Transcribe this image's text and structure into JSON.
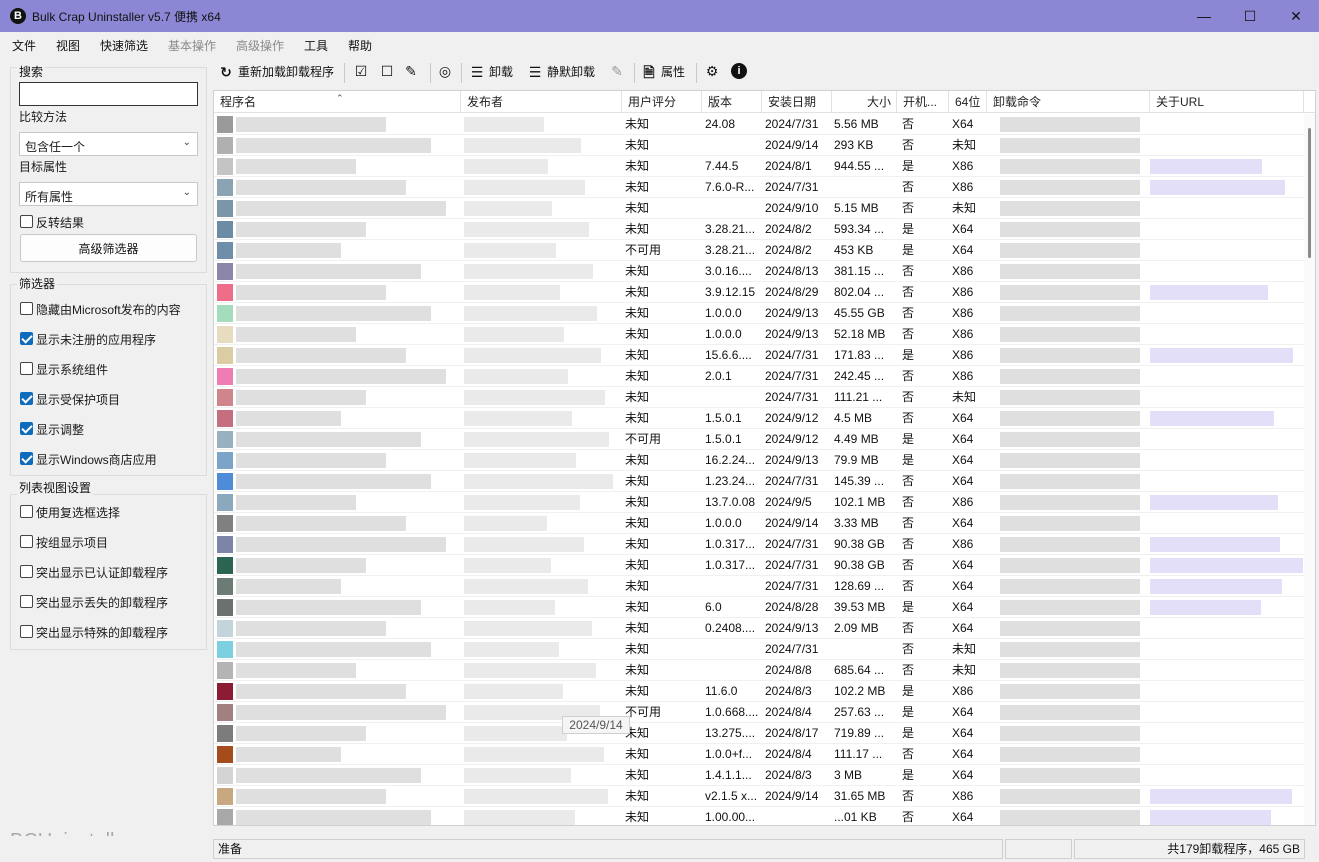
{
  "window": {
    "title": "Bulk Crap Uninstaller v5.7 便携 x64",
    "app_icon_letter": "B"
  },
  "menu": [
    {
      "label": "文件",
      "enabled": true
    },
    {
      "label": "视图",
      "enabled": true
    },
    {
      "label": "快速筛选",
      "enabled": true
    },
    {
      "label": "基本操作",
      "enabled": false
    },
    {
      "label": "高级操作",
      "enabled": false
    },
    {
      "label": "工具",
      "enabled": true
    },
    {
      "label": "帮助",
      "enabled": true
    }
  ],
  "search": {
    "title": "搜索",
    "value": "",
    "compare_label": "比较方法",
    "compare_value": "包含任一个",
    "target_label": "目标属性",
    "target_value": "所有属性",
    "invert": {
      "label": "反转结果",
      "checked": false
    },
    "advanced_button": "高级筛选器"
  },
  "filters": {
    "title": "筛选器",
    "items": [
      {
        "label": "隐藏由Microsoft发布的内容",
        "checked": false
      },
      {
        "label": "显示未注册的应用程序",
        "checked": true
      },
      {
        "label": "显示系统组件",
        "checked": false
      },
      {
        "label": "显示受保护项目",
        "checked": true
      },
      {
        "label": "显示调整",
        "checked": true
      },
      {
        "label": "显示Windows商店应用",
        "checked": true
      }
    ]
  },
  "listview_settings": {
    "title": "列表视图设置",
    "items": [
      {
        "label": "使用复选框选择",
        "checked": false
      },
      {
        "label": "按组显示项目",
        "checked": false
      },
      {
        "label": "突出显示已认证卸载程序",
        "checked": false
      },
      {
        "label": "突出显示丢失的卸载程序",
        "checked": false
      },
      {
        "label": "突出显示特殊的卸载程序",
        "checked": false
      }
    ]
  },
  "brand": "BCUninstaller",
  "toolbar": {
    "reload": "重新加载卸载程序",
    "uninstall": "卸载",
    "quiet_uninstall": "静默卸载",
    "properties": "属性"
  },
  "columns": {
    "name": "程序名",
    "publisher": "发布者",
    "rating": "用户评分",
    "version": "版本",
    "install_date": "安装日期",
    "size": "大小",
    "startup": "开机...",
    "x64": "64位",
    "uninstall_cmd": "卸载命令",
    "about_url": "关于URL"
  },
  "rows": [
    {
      "color": "#9a9a9a",
      "rating": "未知",
      "version": "24.08",
      "date": "2024/7/31",
      "size": "5.56 MB",
      "startup": "否",
      "arch": "X64",
      "url": false
    },
    {
      "color": "#b0b0b0",
      "rating": "未知",
      "version": "",
      "date": "2024/9/14",
      "size": "293 KB",
      "startup": "否",
      "arch": "未知",
      "url": false
    },
    {
      "color": "#c4c4c4",
      "rating": "未知",
      "version": "7.44.5",
      "date": "2024/8/1",
      "size": "944.55 ...",
      "startup": "是",
      "arch": "X86",
      "url": true
    },
    {
      "color": "#8aa4b4",
      "rating": "未知",
      "version": "7.6.0-R...",
      "date": "2024/7/31",
      "size": "",
      "startup": "否",
      "arch": "X86",
      "url": true
    },
    {
      "color": "#7a96a8",
      "rating": "未知",
      "version": "",
      "date": "2024/9/10",
      "size": "5.15 MB",
      "startup": "否",
      "arch": "未知",
      "url": false
    },
    {
      "color": "#6c8ca6",
      "rating": "未知",
      "version": "3.28.21...",
      "date": "2024/8/2",
      "size": "593.34 ...",
      "startup": "是",
      "arch": "X64",
      "url": false
    },
    {
      "color": "#6e8eaa",
      "rating": "不可用",
      "version": "3.28.21...",
      "date": "2024/8/2",
      "size": "453 KB",
      "startup": "是",
      "arch": "X64",
      "url": false
    },
    {
      "color": "#8c86a8",
      "rating": "未知",
      "version": "3.0.16....",
      "date": "2024/8/13",
      "size": "381.15 ...",
      "startup": "否",
      "arch": "X86",
      "url": false
    },
    {
      "color": "#ee6e8a",
      "rating": "未知",
      "version": "3.9.12.15",
      "date": "2024/8/29",
      "size": "802.04 ...",
      "startup": "否",
      "arch": "X86",
      "url": true
    },
    {
      "color": "#a4dcbc",
      "rating": "未知",
      "version": "1.0.0.0",
      "date": "2024/9/13",
      "size": "45.55 GB",
      "startup": "否",
      "arch": "X86",
      "url": false
    },
    {
      "color": "#e8dcc0",
      "rating": "未知",
      "version": "1.0.0.0",
      "date": "2024/9/13",
      "size": "52.18 MB",
      "startup": "否",
      "arch": "X86",
      "url": false
    },
    {
      "color": "#dccca4",
      "rating": "未知",
      "version": "15.6.6....",
      "date": "2024/7/31",
      "size": "171.83 ...",
      "startup": "是",
      "arch": "X86",
      "url": true
    },
    {
      "color": "#f07cb4",
      "rating": "未知",
      "version": "2.0.1",
      "date": "2024/7/31",
      "size": "242.45 ...",
      "startup": "否",
      "arch": "X86",
      "url": false
    },
    {
      "color": "#d0848c",
      "rating": "未知",
      "version": "",
      "date": "2024/7/31",
      "size": "111.21 ...",
      "startup": "否",
      "arch": "未知",
      "url": false
    },
    {
      "color": "#c46e80",
      "rating": "未知",
      "version": "1.5.0.1",
      "date": "2024/9/12",
      "size": "4.5 MB",
      "startup": "否",
      "arch": "X64",
      "url": true
    },
    {
      "color": "#98b0c0",
      "rating": "不可用",
      "version": "1.5.0.1",
      "date": "2024/9/12",
      "size": "4.49 MB",
      "startup": "是",
      "arch": "X64",
      "url": false
    },
    {
      "color": "#7ca4c8",
      "rating": "未知",
      "version": "16.2.24...",
      "date": "2024/9/13",
      "size": "79.9 MB",
      "startup": "是",
      "arch": "X64",
      "url": false
    },
    {
      "color": "#4e8cd8",
      "rating": "未知",
      "version": "1.23.24...",
      "date": "2024/7/31",
      "size": "145.39 ...",
      "startup": "否",
      "arch": "X64",
      "url": false
    },
    {
      "color": "#8ca8bc",
      "rating": "未知",
      "version": "13.7.0.08",
      "date": "2024/9/5",
      "size": "102.1 MB",
      "startup": "否",
      "arch": "X86",
      "url": true
    },
    {
      "color": "#808080",
      "rating": "未知",
      "version": "1.0.0.0",
      "date": "2024/9/14",
      "size": "3.33 MB",
      "startup": "否",
      "arch": "X64",
      "url": false
    },
    {
      "color": "#7c84a8",
      "rating": "未知",
      "version": "1.0.317...",
      "date": "2024/7/31",
      "size": "90.38 GB",
      "startup": "否",
      "arch": "X86",
      "url": true
    },
    {
      "color": "#2c6454",
      "rating": "未知",
      "version": "1.0.317...",
      "date": "2024/7/31",
      "size": "90.38 GB",
      "startup": "否",
      "arch": "X64",
      "url": true
    },
    {
      "color": "#6c7c74",
      "rating": "未知",
      "version": "",
      "date": "2024/7/31",
      "size": "128.69 ...",
      "startup": "否",
      "arch": "X64",
      "url": true
    },
    {
      "color": "#6c7070",
      "rating": "未知",
      "version": "6.0",
      "date": "2024/8/28",
      "size": "39.53 MB",
      "startup": "是",
      "arch": "X64",
      "url": true
    },
    {
      "color": "#c4d4dc",
      "rating": "未知",
      "version": "0.2408....",
      "date": "2024/9/13",
      "size": "2.09 MB",
      "startup": "否",
      "arch": "X64",
      "url": false
    },
    {
      "color": "#7cd0e0",
      "rating": "未知",
      "version": "",
      "date": "2024/7/31",
      "size": "",
      "startup": "否",
      "arch": "未知",
      "url": false
    },
    {
      "color": "#b4b4b4",
      "rating": "未知",
      "version": "",
      "date": "2024/8/8",
      "size": "685.64 ...",
      "startup": "否",
      "arch": "未知",
      "url": false
    },
    {
      "color": "#8c1c34",
      "rating": "未知",
      "version": "11.6.0",
      "date": "2024/8/3",
      "size": "102.2 MB",
      "startup": "是",
      "arch": "X86",
      "url": false
    },
    {
      "color": "#a08080",
      "rating": "不可用",
      "version": "1.0.668....",
      "date": "2024/8/4",
      "size": "257.63 ...",
      "startup": "是",
      "arch": "X64",
      "url": false
    },
    {
      "color": "#7c7c7c",
      "rating": "未知",
      "version": "13.275....",
      "date": "2024/8/17",
      "size": "719.89 ...",
      "startup": "是",
      "arch": "X64",
      "url": false
    },
    {
      "color": "#a44c1c",
      "rating": "未知",
      "version": "1.0.0+f...",
      "date": "2024/8/4",
      "size": "111.17 ...",
      "startup": "否",
      "arch": "X64",
      "url": false
    },
    {
      "color": "#d4d4d4",
      "rating": "未知",
      "version": "1.4.1.1...",
      "date": "2024/8/3",
      "size": "3 MB",
      "startup": "是",
      "arch": "X64",
      "url": false
    },
    {
      "color": "#c8a880",
      "rating": "未知",
      "version": "v2.1.5 x...",
      "date": "2024/9/14",
      "size": "31.65 MB",
      "startup": "否",
      "arch": "X86",
      "url": true
    },
    {
      "color": "#a8a8a8",
      "rating": "未知",
      "version": "1.00.00...",
      "date": "",
      "size": "...01 KB",
      "startup": "否",
      "arch": "X64",
      "url": true
    }
  ],
  "tooltip": "2024/9/14",
  "status": {
    "left": "准备",
    "right": "共179卸载程序，465 GB"
  }
}
